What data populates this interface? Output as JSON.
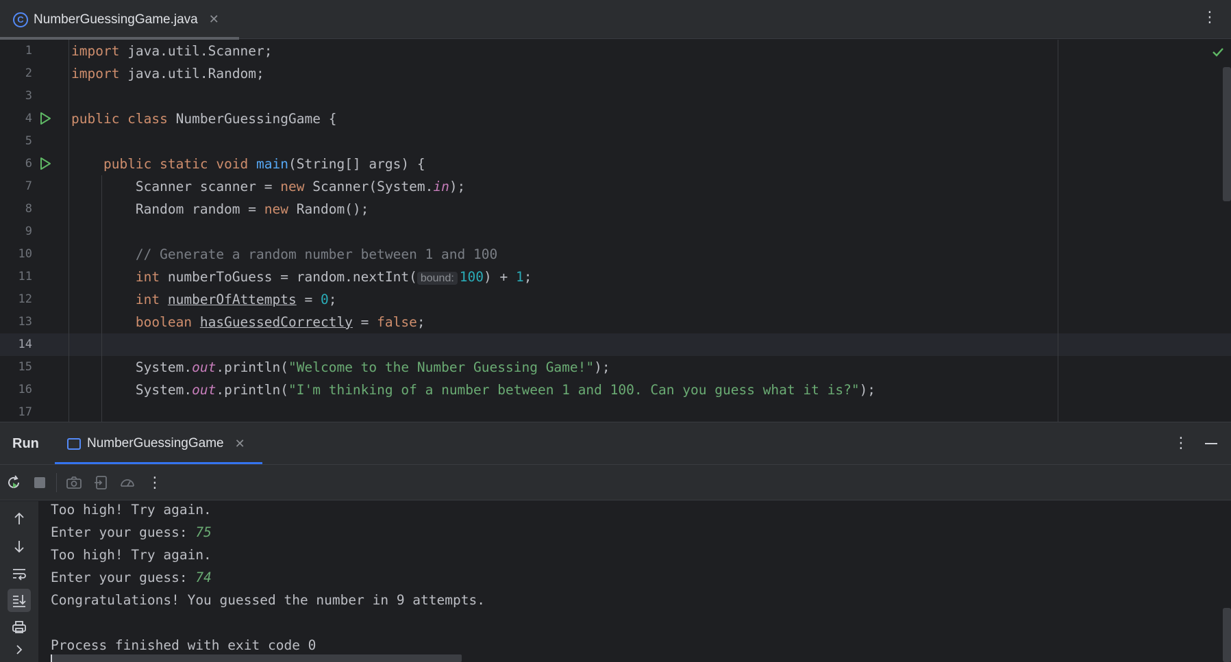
{
  "editor_tab": {
    "icon": "class-c-icon",
    "label": "NumberGuessingGame.java"
  },
  "editor": {
    "current_line": 14,
    "lines": [
      {
        "n": "1",
        "tokens": [
          {
            "t": "import",
            "c": "kw"
          },
          {
            "t": " java.util.Scanner;"
          }
        ]
      },
      {
        "n": "2",
        "tokens": [
          {
            "t": "import",
            "c": "kw"
          },
          {
            "t": " java.util.Random;"
          }
        ]
      },
      {
        "n": "3",
        "tokens": []
      },
      {
        "n": "4",
        "run": true,
        "tokens": [
          {
            "t": "public class",
            "c": "kw"
          },
          {
            "t": " NumberGuessingGame {"
          }
        ]
      },
      {
        "n": "5",
        "tokens": []
      },
      {
        "n": "6",
        "run": true,
        "tokens": [
          {
            "t": "    "
          },
          {
            "t": "public static void",
            "c": "kw"
          },
          {
            "t": " "
          },
          {
            "t": "main",
            "c": "fn"
          },
          {
            "t": "(String[] args) {"
          }
        ]
      },
      {
        "n": "7",
        "tokens": [
          {
            "t": "        Scanner scanner = "
          },
          {
            "t": "new",
            "c": "kw"
          },
          {
            "t": " Scanner(System."
          },
          {
            "t": "in",
            "c": "stat"
          },
          {
            "t": ");"
          }
        ]
      },
      {
        "n": "8",
        "tokens": [
          {
            "t": "        Random random = "
          },
          {
            "t": "new",
            "c": "kw"
          },
          {
            "t": " Random();"
          }
        ]
      },
      {
        "n": "9",
        "tokens": []
      },
      {
        "n": "10",
        "tokens": [
          {
            "t": "        // Generate a random number between 1 and 100",
            "c": "cmt"
          }
        ]
      },
      {
        "n": "11",
        "tokens": [
          {
            "t": "        "
          },
          {
            "t": "int",
            "c": "kw"
          },
          {
            "t": " numberToGuess = random.nextInt("
          },
          {
            "t": "bound:",
            "c": "hint"
          },
          {
            "t": "100",
            "c": "num"
          },
          {
            "t": ") + "
          },
          {
            "t": "1",
            "c": "num"
          },
          {
            "t": ";"
          }
        ]
      },
      {
        "n": "12",
        "tokens": [
          {
            "t": "        "
          },
          {
            "t": "int",
            "c": "kw"
          },
          {
            "t": " "
          },
          {
            "t": "numberOfAttempts",
            "c": "ul"
          },
          {
            "t": " = "
          },
          {
            "t": "0",
            "c": "num"
          },
          {
            "t": ";"
          }
        ]
      },
      {
        "n": "13",
        "tokens": [
          {
            "t": "        "
          },
          {
            "t": "boolean",
            "c": "kw"
          },
          {
            "t": " "
          },
          {
            "t": "hasGuessedCorrectly",
            "c": "ul"
          },
          {
            "t": " = "
          },
          {
            "t": "false",
            "c": "kw"
          },
          {
            "t": ";"
          }
        ]
      },
      {
        "n": "14",
        "tokens": []
      },
      {
        "n": "15",
        "tokens": [
          {
            "t": "        System."
          },
          {
            "t": "out",
            "c": "stat"
          },
          {
            "t": ".println("
          },
          {
            "t": "\"Welcome to the Number Guessing Game!\"",
            "c": "str"
          },
          {
            "t": ");"
          }
        ]
      },
      {
        "n": "16",
        "tokens": [
          {
            "t": "        System."
          },
          {
            "t": "out",
            "c": "stat"
          },
          {
            "t": ".println("
          },
          {
            "t": "\"I'm thinking of a number between 1 and 100. Can you guess what it is?\"",
            "c": "str"
          },
          {
            "t": ");"
          }
        ]
      },
      {
        "n": "17",
        "tokens": []
      }
    ]
  },
  "run_window": {
    "title": "Run",
    "tab_label": "NumberGuessingGame",
    "toolbar_icons": [
      "rerun-icon",
      "stop-icon",
      "camera-icon",
      "restore-layout-icon",
      "profiler-icon",
      "more-icon"
    ],
    "side_icons": [
      "arrow-up-icon",
      "arrow-down-icon",
      "soft-wrap-icon",
      "scroll-to-end-icon",
      "print-icon",
      "expand-icon"
    ]
  },
  "console": {
    "lines": [
      {
        "text": "Too high! Try again."
      },
      {
        "text": "Enter your guess: ",
        "input": "75"
      },
      {
        "text": "Too high! Try again."
      },
      {
        "text": "Enter your guess: ",
        "input": "74"
      },
      {
        "text": "Congratulations! You guessed the number in 9 attempts."
      },
      {
        "text": ""
      },
      {
        "text": "Process finished with exit code 0"
      }
    ]
  },
  "colors": {
    "accent": "#3574f0",
    "run_green": "#5fb865",
    "keyword": "#cf8e6d",
    "string": "#6aab73",
    "number": "#2aacb8"
  }
}
